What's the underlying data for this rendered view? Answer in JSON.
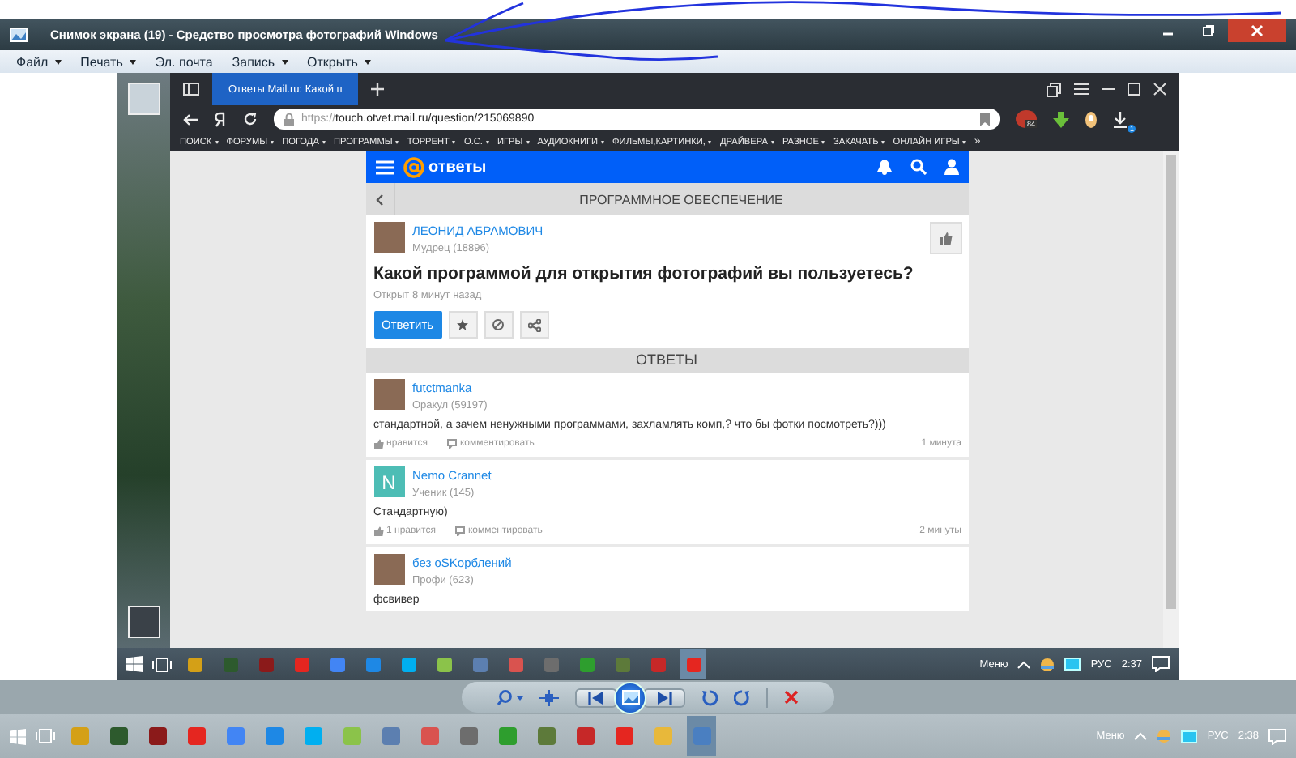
{
  "window": {
    "title": "Снимок экрана (19) - Средство просмотра фотографий Windows"
  },
  "menu": [
    {
      "label": "Файл",
      "has_dropdown": true
    },
    {
      "label": "Печать",
      "has_dropdown": true
    },
    {
      "label": "Эл. почта",
      "has_dropdown": false
    },
    {
      "label": "Запись",
      "has_dropdown": true
    },
    {
      "label": "Открыть",
      "has_dropdown": true
    }
  ],
  "browser": {
    "tab_title": "Ответы Mail.ru: Какой п",
    "url_scheme": "https://",
    "url_rest": "touch.otvet.mail.ru/question/215069890",
    "adblock_badge": "84",
    "downloads_badge": "1",
    "bookmarks_more": "»",
    "bookmarks": [
      {
        "label": "ПОИСК",
        "has_dropdown": true
      },
      {
        "label": "ФОРУМЫ",
        "has_dropdown": true
      },
      {
        "label": "ПОГОДА",
        "has_dropdown": true
      },
      {
        "label": "ПРОГРАММЫ",
        "has_dropdown": true
      },
      {
        "label": "ТОРРЕНТ",
        "has_dropdown": true
      },
      {
        "label": "О.С.",
        "has_dropdown": true
      },
      {
        "label": "ИГРЫ",
        "has_dropdown": true
      },
      {
        "label": "АУДИОКНИГИ",
        "has_dropdown": true
      },
      {
        "label": "ФИЛЬМЫ,КАРТИНКИ,",
        "has_dropdown": true
      },
      {
        "label": "ДРАЙВЕРА",
        "has_dropdown": true
      },
      {
        "label": "РАЗНОЕ",
        "has_dropdown": true
      },
      {
        "label": "ЗАКАЧАТЬ",
        "has_dropdown": true
      },
      {
        "label": "ОНЛАЙН ИГРЫ",
        "has_dropdown": true
      }
    ]
  },
  "site": {
    "logo": "ответы",
    "category": "ПРОГРАММНОЕ ОБЕСПЕЧЕНИЕ",
    "question": {
      "author": "ЛЕОНИД АБРАМОВИЧ",
      "rank": "Мудрец (18896)",
      "title": "Какой программой для открытия фотографий вы пользуетесь?",
      "opened": "Открыт 8 минут назад",
      "answer_button": "Ответить"
    },
    "answers_heading": "ОТВЕТЫ",
    "answers": [
      {
        "author": "futctmanka",
        "rank": "Оракул (59197)",
        "avatar": {
          "kind": "photo"
        },
        "text": "стандартной, а зачем ненужными программами, захламлять комп,? что бы фотки посмотреть?)))",
        "like": "нравится",
        "comment": "комментировать",
        "time": "1 минута"
      },
      {
        "author": "Nemo Crannet",
        "rank": "Ученик (145)",
        "avatar": {
          "kind": "letter",
          "letter": "N",
          "color": "#4dbdb5"
        },
        "text": "Стандартную)",
        "like": "1 нравится",
        "comment": "комментировать",
        "time": "2 минуты"
      },
      {
        "author": "без оSKорблений",
        "rank": "Профи (623)",
        "avatar": {
          "kind": "photo"
        },
        "text": "фсвивер"
      }
    ]
  },
  "inner_taskbar": {
    "menu_label": "Меню",
    "language": "РУС",
    "time": "2:37",
    "apps": [
      {
        "color": "#d4a017",
        "active": false
      },
      {
        "color": "#2d5a2d",
        "active": false
      },
      {
        "color": "#8b1a1a",
        "active": false
      },
      {
        "color": "#e52620",
        "active": false
      },
      {
        "color": "#4285f4",
        "active": false
      },
      {
        "color": "#1e88e5",
        "active": false
      },
      {
        "color": "#00aff0",
        "active": false
      },
      {
        "color": "#8bc34a",
        "active": false
      },
      {
        "color": "#5c7fb0",
        "active": false
      },
      {
        "color": "#d9534f",
        "active": false
      },
      {
        "color": "#6d6d6d",
        "active": false
      },
      {
        "color": "#2e9e2e",
        "active": false
      },
      {
        "color": "#5d7a3a",
        "active": false
      },
      {
        "color": "#c62828",
        "active": false
      },
      {
        "color": "#e52620",
        "active": true
      }
    ]
  },
  "taskbar": {
    "menu_label": "Меню",
    "language": "РУС",
    "time": "2:38",
    "apps": [
      {
        "color": "#d4a017",
        "active": false
      },
      {
        "color": "#2d5a2d",
        "active": false
      },
      {
        "color": "#8b1a1a",
        "active": false
      },
      {
        "color": "#e52620",
        "active": false
      },
      {
        "color": "#4285f4",
        "active": false
      },
      {
        "color": "#1e88e5",
        "active": false
      },
      {
        "color": "#00aff0",
        "active": false
      },
      {
        "color": "#8bc34a",
        "active": false
      },
      {
        "color": "#5c7fb0",
        "active": false
      },
      {
        "color": "#d9534f",
        "active": false
      },
      {
        "color": "#6d6d6d",
        "active": false
      },
      {
        "color": "#2e9e2e",
        "active": false
      },
      {
        "color": "#5d7a3a",
        "active": false
      },
      {
        "color": "#c62828",
        "active": false
      },
      {
        "color": "#e52620",
        "active": false
      },
      {
        "color": "#e8b83a",
        "active": false
      },
      {
        "color": "#4a7fc1",
        "active": true
      }
    ]
  }
}
